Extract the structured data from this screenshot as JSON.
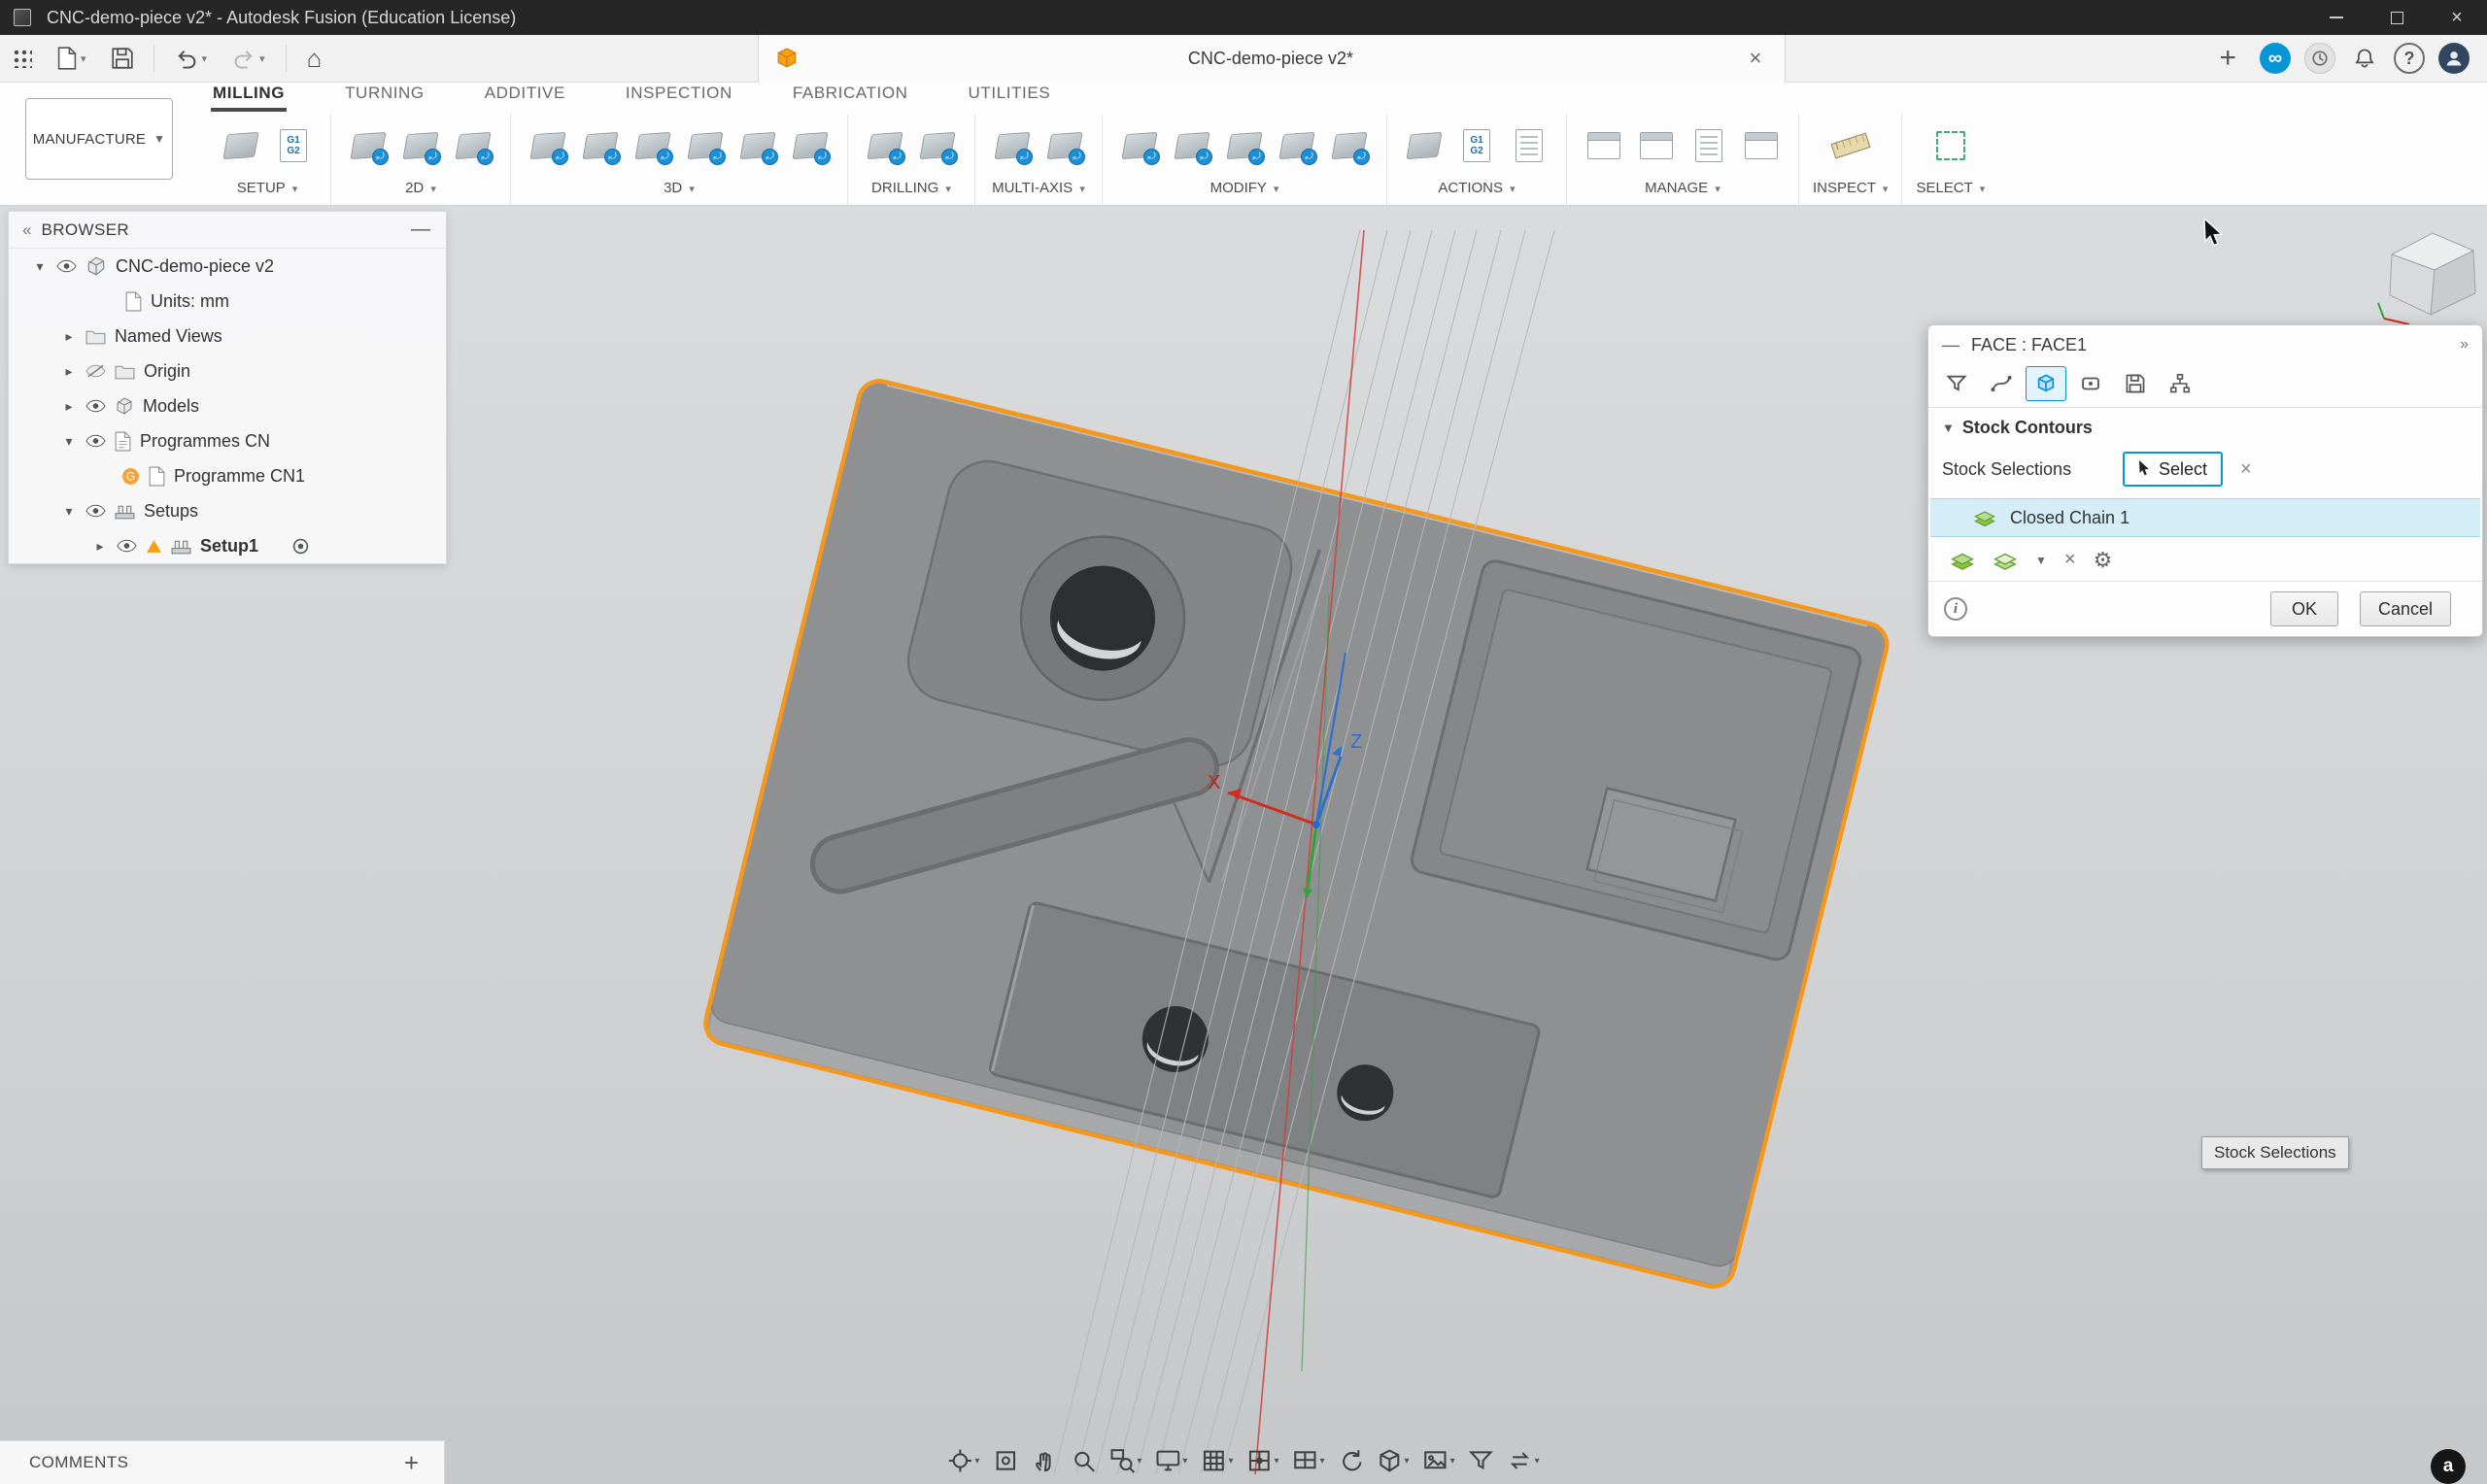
{
  "window": {
    "title": "CNC-demo-piece v2* - Autodesk Fusion (Education License)"
  },
  "tab_bar": {
    "document_tab": "CNC-demo-piece v2*",
    "new_tab": "+",
    "close_tab": "×"
  },
  "ribbon": {
    "workspace": "MANUFACTURE",
    "active_tab": "MILLING",
    "tabs": [
      "MILLING",
      "TURNING",
      "ADDITIVE",
      "INSPECTION",
      "FABRICATION",
      "UTILITIES"
    ],
    "groups": [
      {
        "label": "SETUP",
        "icons": [
          {
            "name": "new-setup",
            "type": "chip-plain"
          },
          {
            "name": "gcode-editor",
            "type": "gcode"
          }
        ]
      },
      {
        "label": "2D",
        "icons": [
          {
            "name": "2d-adaptive",
            "type": "chip"
          },
          {
            "name": "2d-pocket",
            "type": "chip"
          },
          {
            "name": "2d-contour",
            "type": "chip"
          }
        ]
      },
      {
        "label": "3D",
        "icons": [
          {
            "name": "3d-adaptive",
            "type": "chip"
          },
          {
            "name": "3d-pocket",
            "type": "chip"
          },
          {
            "name": "3d-parallel",
            "type": "chip"
          },
          {
            "name": "3d-scallop",
            "type": "chip"
          },
          {
            "name": "3d-spiral",
            "type": "chip"
          },
          {
            "name": "3d-morph",
            "type": "chip"
          }
        ]
      },
      {
        "label": "DRILLING",
        "icons": [
          {
            "name": "drill",
            "type": "chip"
          },
          {
            "name": "bore",
            "type": "chip"
          }
        ]
      },
      {
        "label": "MULTI-AXIS",
        "icons": [
          {
            "name": "swarf",
            "type": "chip"
          },
          {
            "name": "rotary",
            "type": "chip"
          }
        ]
      },
      {
        "label": "MODIFY",
        "icons": [
          {
            "name": "trim-toolpath",
            "type": "chip"
          },
          {
            "name": "delete-passes",
            "type": "chip"
          },
          {
            "name": "feed-optimization",
            "type": "chip"
          },
          {
            "name": "link-toolpath",
            "type": "chip"
          },
          {
            "name": "transform-toolpath",
            "type": "chip"
          }
        ]
      },
      {
        "label": "ACTIONS",
        "icons": [
          {
            "name": "simulate",
            "type": "chip-plain"
          },
          {
            "name": "post-process",
            "type": "gcode"
          },
          {
            "name": "setup-sheet",
            "type": "sheet"
          }
        ]
      },
      {
        "label": "MANAGE",
        "icons": [
          {
            "name": "tool-library",
            "type": "panel"
          },
          {
            "name": "task-manager",
            "type": "panel"
          },
          {
            "name": "templates",
            "type": "sheet"
          },
          {
            "name": "machine-library",
            "type": "panel"
          }
        ]
      },
      {
        "label": "INSPECT",
        "icons": [
          {
            "name": "measure",
            "type": "measure"
          }
        ]
      },
      {
        "label": "SELECT",
        "icons": [
          {
            "name": "selection-window",
            "type": "dashed"
          }
        ]
      }
    ]
  },
  "browser": {
    "title": "BROWSER",
    "items": [
      {
        "label": "CNC-demo-piece v2",
        "indent": 24,
        "chevron": "down",
        "eye": "on",
        "icons": [
          "assembly"
        ]
      },
      {
        "label": "Units: mm",
        "indent": 120,
        "chevron": null,
        "eye": null,
        "icons": [
          "doc"
        ]
      },
      {
        "label": "Named Views",
        "indent": 54,
        "chevron": "right",
        "eye": null,
        "icons": [
          "folder"
        ]
      },
      {
        "label": "Origin",
        "indent": 54,
        "chevron": "right",
        "eye": "off",
        "icons": [
          "folder"
        ]
      },
      {
        "label": "Models",
        "indent": 54,
        "chevron": "right",
        "eye": "on",
        "icons": [
          "component"
        ]
      },
      {
        "label": "Programmes CN",
        "indent": 54,
        "chevron": "down",
        "eye": "on",
        "icons": [
          "cam-doc"
        ]
      },
      {
        "label": "Programme CN1",
        "indent": 116,
        "chevron": null,
        "eye": null,
        "icons": [
          "cam-badge",
          "doc"
        ]
      },
      {
        "label": "Setups",
        "indent": 54,
        "chevron": "down",
        "eye": "on",
        "icons": [
          "setups"
        ]
      },
      {
        "label": "Setup1",
        "indent": 86,
        "chevron": "right",
        "eye": "on",
        "icons": [
          "warn-triangle",
          "setup"
        ],
        "bold": true,
        "radio": true
      }
    ]
  },
  "dialog": {
    "title": "FACE : FACE1",
    "collapse": "—",
    "expand": "»",
    "tabs": [
      {
        "name": "filter"
      },
      {
        "name": "profile"
      },
      {
        "name": "stock",
        "active": true
      },
      {
        "name": "surface"
      },
      {
        "name": "save"
      },
      {
        "name": "tree"
      }
    ],
    "section": "Stock Contours",
    "selection_label": "Stock Selections",
    "select_button": "Select",
    "clear": "×",
    "chain": "Closed Chain 1",
    "ok": "OK",
    "cancel": "Cancel"
  },
  "tooltip": "Stock Selections",
  "axis": {
    "x": "X",
    "z": "Z"
  },
  "comments": {
    "label": "COMMENTS",
    "add": "+"
  },
  "bottom_toolbar": [
    {
      "name": "orbit",
      "caret": true
    },
    {
      "name": "look-at",
      "caret": false
    },
    {
      "name": "pan",
      "caret": false
    },
    {
      "name": "zoom",
      "caret": false
    },
    {
      "name": "zoom-window",
      "caret": true
    },
    {
      "name": "display-settings",
      "caret": true
    },
    {
      "name": "grid",
      "caret": true
    },
    {
      "name": "snaps",
      "caret": true
    },
    {
      "name": "viewports",
      "caret": true
    },
    {
      "name": "refresh",
      "caret": false
    },
    {
      "name": "visual-style",
      "caret": true
    },
    {
      "name": "canvas",
      "caret": true
    },
    {
      "name": "selection-filter",
      "caret": false
    },
    {
      "name": "swap",
      "caret": true
    }
  ]
}
